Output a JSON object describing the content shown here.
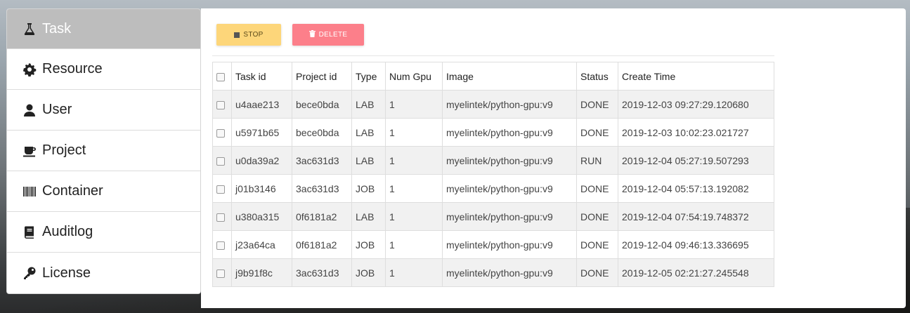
{
  "sidebar": {
    "items": [
      {
        "label": "Task",
        "icon": "flask-icon",
        "active": true
      },
      {
        "label": "Resource",
        "icon": "gear-icon",
        "active": false
      },
      {
        "label": "User",
        "icon": "user-icon",
        "active": false
      },
      {
        "label": "Project",
        "icon": "coffee-icon",
        "active": false
      },
      {
        "label": "Container",
        "icon": "barcode-icon",
        "active": false
      },
      {
        "label": "Auditlog",
        "icon": "book-icon",
        "active": false
      },
      {
        "label": "License",
        "icon": "key-icon",
        "active": false
      }
    ]
  },
  "toolbar": {
    "stop_label": "STOP",
    "delete_label": "DELETE",
    "stop_color": "#fdd67a",
    "delete_color": "#fc7f8a"
  },
  "table": {
    "headers": [
      "Task id",
      "Project id",
      "Type",
      "Num Gpu",
      "Image",
      "Status",
      "Create Time"
    ],
    "rows": [
      [
        "u4aae213",
        "bece0bda",
        "LAB",
        "1",
        "myelintek/python-gpu:v9",
        "DONE",
        "2019-12-03 09:27:29.120680"
      ],
      [
        "u5971b65",
        "bece0bda",
        "LAB",
        "1",
        "myelintek/python-gpu:v9",
        "DONE",
        "2019-12-03 10:02:23.021727"
      ],
      [
        "u0da39a2",
        "3ac631d3",
        "LAB",
        "1",
        "myelintek/python-gpu:v9",
        "RUN",
        "2019-12-04 05:27:19.507293"
      ],
      [
        "j01b3146",
        "3ac631d3",
        "JOB",
        "1",
        "myelintek/python-gpu:v9",
        "DONE",
        "2019-12-04 05:57:13.192082"
      ],
      [
        "u380a315",
        "0f6181a2",
        "LAB",
        "1",
        "myelintek/python-gpu:v9",
        "DONE",
        "2019-12-04 07:54:19.748372"
      ],
      [
        "j23a64ca",
        "0f6181a2",
        "JOB",
        "1",
        "myelintek/python-gpu:v9",
        "DONE",
        "2019-12-04 09:46:13.336695"
      ],
      [
        "j9b91f8c",
        "3ac631d3",
        "JOB",
        "1",
        "myelintek/python-gpu:v9",
        "DONE",
        "2019-12-05 02:21:27.245548"
      ]
    ]
  }
}
